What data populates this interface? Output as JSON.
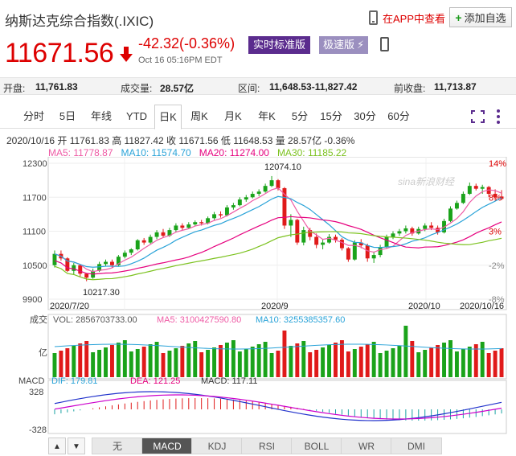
{
  "header": {
    "title": "纳斯达克综合指数(.IXIC)",
    "app_link": "在APP中查看",
    "add_button": "添加自选",
    "price": "11671.56",
    "change": "-42.32(-0.36%)",
    "time": "Oct 16 05:16PM EDT",
    "btn_standard": "实时标准版",
    "btn_fast": "极速版",
    "colors": {
      "down": "#dd0000",
      "accent": "#5b2c8e"
    }
  },
  "stats": {
    "open_label": "开盘:",
    "open": "11,761.83",
    "volume_label": "成交量:",
    "volume": "28.57亿",
    "range_label": "区间:",
    "range": "11,648.53-11,827.42",
    "prev_close_label": "前收盘:",
    "prev_close": "11,713.87"
  },
  "tabs": [
    "分时",
    "5日",
    "年线",
    "YTD",
    "日K",
    "周K",
    "月K",
    "年K",
    "5分",
    "15分",
    "30分",
    "60分"
  ],
  "active_tab": "日K",
  "info_line": "2020/10/16 开 11761.83 高 11827.42 收 11671.56 低 11648.53 量 28.57亿 -0.36%",
  "ma": {
    "ma5": "MA5: 11778.87",
    "ma10": "MA10: 11574.70",
    "ma20": "MA20: 11274.00",
    "ma30": "MA30: 11185.22"
  },
  "chart_data": {
    "type": "candlestick",
    "y_ticks": [
      "12300",
      "11700",
      "11100",
      "10500",
      "9900"
    ],
    "pct_ticks": [
      "14%",
      "8%",
      "3%",
      "-2%",
      "-8%"
    ],
    "x_ticks": [
      "2020/7/20",
      "2020/9",
      "2020/10",
      "2020/10/16"
    ],
    "annotations": [
      "12074.10",
      "10217.30"
    ],
    "watermark": "sina新浪财经",
    "candles": [
      {
        "o": 10500,
        "c": 10700,
        "h": 10760,
        "l": 10460
      },
      {
        "o": 10700,
        "c": 10620,
        "h": 10760,
        "l": 10580
      },
      {
        "o": 10620,
        "c": 10400,
        "h": 10640,
        "l": 10380
      },
      {
        "o": 10400,
        "c": 10500,
        "h": 10540,
        "l": 10330
      },
      {
        "o": 10500,
        "c": 10350,
        "h": 10520,
        "l": 10300
      },
      {
        "o": 10350,
        "c": 10280,
        "h": 10360,
        "l": 10217
      },
      {
        "o": 10280,
        "c": 10400,
        "h": 10440,
        "l": 10260
      },
      {
        "o": 10400,
        "c": 10520,
        "h": 10560,
        "l": 10380
      },
      {
        "o": 10520,
        "c": 10560,
        "h": 10600,
        "l": 10480
      },
      {
        "o": 10560,
        "c": 10500,
        "h": 10600,
        "l": 10460
      },
      {
        "o": 10500,
        "c": 10650,
        "h": 10680,
        "l": 10480
      },
      {
        "o": 10650,
        "c": 10720,
        "h": 10760,
        "l": 10620
      },
      {
        "o": 10720,
        "c": 10780,
        "h": 10800,
        "l": 10680
      },
      {
        "o": 10780,
        "c": 10940,
        "h": 10960,
        "l": 10760
      },
      {
        "o": 10940,
        "c": 10900,
        "h": 10980,
        "l": 10860
      },
      {
        "o": 10900,
        "c": 11000,
        "h": 11040,
        "l": 10880
      },
      {
        "o": 11000,
        "c": 11080,
        "h": 11120,
        "l": 10960
      },
      {
        "o": 11080,
        "c": 11020,
        "h": 11140,
        "l": 10990
      },
      {
        "o": 11020,
        "c": 11120,
        "h": 11160,
        "l": 11000
      },
      {
        "o": 11120,
        "c": 11200,
        "h": 11240,
        "l": 11080
      },
      {
        "o": 11200,
        "c": 11160,
        "h": 11240,
        "l": 11120
      },
      {
        "o": 11160,
        "c": 11220,
        "h": 11260,
        "l": 11140
      },
      {
        "o": 11220,
        "c": 11260,
        "h": 11290,
        "l": 11190
      },
      {
        "o": 11260,
        "c": 11240,
        "h": 11300,
        "l": 11200
      },
      {
        "o": 11240,
        "c": 11330,
        "h": 11360,
        "l": 11220
      },
      {
        "o": 11330,
        "c": 11400,
        "h": 11440,
        "l": 11300
      },
      {
        "o": 11400,
        "c": 11380,
        "h": 11450,
        "l": 11340
      },
      {
        "o": 11380,
        "c": 11520,
        "h": 11560,
        "l": 11360
      },
      {
        "o": 11520,
        "c": 11560,
        "h": 11600,
        "l": 11480
      },
      {
        "o": 11560,
        "c": 11660,
        "h": 11700,
        "l": 11540
      },
      {
        "o": 11660,
        "c": 11700,
        "h": 11740,
        "l": 11620
      },
      {
        "o": 11700,
        "c": 11760,
        "h": 11800,
        "l": 11680
      },
      {
        "o": 11760,
        "c": 11800,
        "h": 11840,
        "l": 11720
      },
      {
        "o": 11800,
        "c": 11900,
        "h": 11940,
        "l": 11780
      },
      {
        "o": 11900,
        "c": 12000,
        "h": 12074,
        "l": 11880
      },
      {
        "o": 12000,
        "c": 11860,
        "h": 12020,
        "l": 11820
      },
      {
        "o": 11860,
        "c": 11200,
        "h": 11880,
        "l": 11140
      },
      {
        "o": 11200,
        "c": 11300,
        "h": 11400,
        "l": 11000
      },
      {
        "o": 11300,
        "c": 10900,
        "h": 11320,
        "l": 10860
      },
      {
        "o": 10900,
        "c": 11120,
        "h": 11180,
        "l": 10850
      },
      {
        "o": 11120,
        "c": 11000,
        "h": 11160,
        "l": 10940
      },
      {
        "o": 11000,
        "c": 10860,
        "h": 11060,
        "l": 10800
      },
      {
        "o": 10860,
        "c": 10900,
        "h": 10960,
        "l": 10780
      },
      {
        "o": 10900,
        "c": 11000,
        "h": 11050,
        "l": 10880
      },
      {
        "o": 11000,
        "c": 10950,
        "h": 11040,
        "l": 10900
      },
      {
        "o": 10950,
        "c": 10800,
        "h": 10980,
        "l": 10760
      },
      {
        "o": 10800,
        "c": 10600,
        "h": 10820,
        "l": 10560
      },
      {
        "o": 10600,
        "c": 10900,
        "h": 10940,
        "l": 10580
      },
      {
        "o": 10900,
        "c": 10850,
        "h": 10960,
        "l": 10800
      },
      {
        "o": 10850,
        "c": 10620,
        "h": 10880,
        "l": 10560
      },
      {
        "o": 10620,
        "c": 10680,
        "h": 10740,
        "l": 10540
      },
      {
        "o": 10680,
        "c": 10820,
        "h": 10860,
        "l": 10640
      },
      {
        "o": 10820,
        "c": 11000,
        "h": 11040,
        "l": 10800
      },
      {
        "o": 11000,
        "c": 11060,
        "h": 11100,
        "l": 10960
      },
      {
        "o": 11060,
        "c": 11100,
        "h": 11140,
        "l": 11020
      },
      {
        "o": 11100,
        "c": 11150,
        "h": 11200,
        "l": 11060
      },
      {
        "o": 11150,
        "c": 11060,
        "h": 11180,
        "l": 11020
      },
      {
        "o": 11060,
        "c": 11140,
        "h": 11180,
        "l": 11040
      },
      {
        "o": 11140,
        "c": 11200,
        "h": 11240,
        "l": 11100
      },
      {
        "o": 11200,
        "c": 11160,
        "h": 11260,
        "l": 11120
      },
      {
        "o": 11160,
        "c": 11080,
        "h": 11200,
        "l": 11040
      },
      {
        "o": 11080,
        "c": 11280,
        "h": 11320,
        "l": 11060
      },
      {
        "o": 11280,
        "c": 11500,
        "h": 11540,
        "l": 11260
      },
      {
        "o": 11500,
        "c": 11600,
        "h": 11640,
        "l": 11480
      },
      {
        "o": 11600,
        "c": 11760,
        "h": 11800,
        "l": 11580
      },
      {
        "o": 11760,
        "c": 11900,
        "h": 11960,
        "l": 11740
      },
      {
        "o": 11900,
        "c": 11850,
        "h": 11940,
        "l": 11820
      },
      {
        "o": 11850,
        "c": 11880,
        "h": 11920,
        "l": 11760
      },
      {
        "o": 11880,
        "c": 11760,
        "h": 11900,
        "l": 11700
      },
      {
        "o": 11760,
        "c": 11700,
        "h": 11840,
        "l": 11640
      },
      {
        "o": 11713,
        "c": 11671,
        "h": 11827,
        "l": 11648
      }
    ],
    "volume_label": "成交",
    "volume_unit": "亿",
    "vol_text": "VOL: 2856703733.00",
    "vol_ma5": "MA5: 3100427590.80",
    "vol_ma10": "MA10: 3255385357.60",
    "macd_label": "MACD",
    "macd_dif": "DIF: 179.81",
    "macd_dea": "DEA: 121.25",
    "macd_val": "MACD: 117.11",
    "macd_ticks": [
      "328",
      "-328"
    ]
  },
  "bottom_bar": [
    "无",
    "MACD",
    "KDJ",
    "RSI",
    "BOLL",
    "WR",
    "DMI"
  ],
  "bottom_active": "MACD"
}
